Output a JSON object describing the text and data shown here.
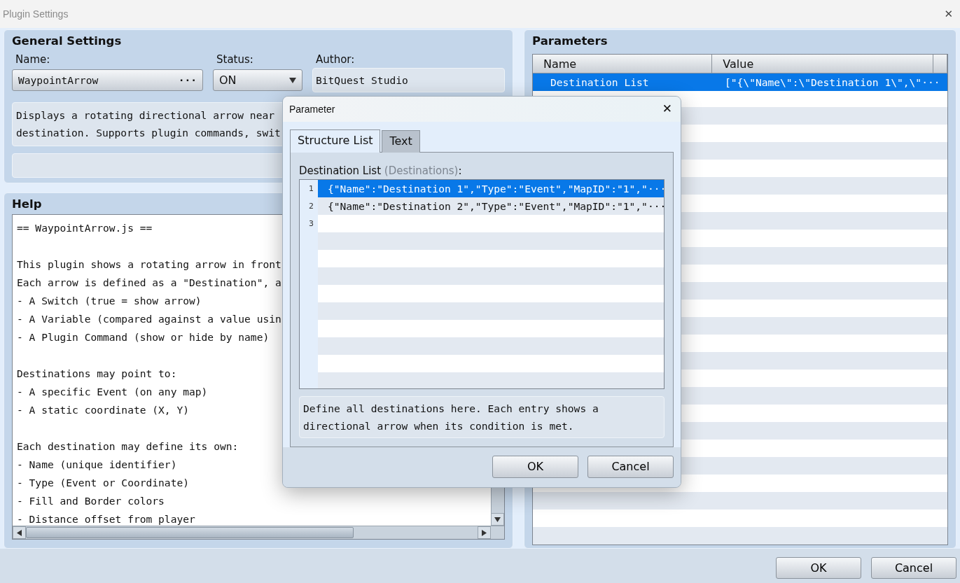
{
  "window": {
    "title": "Plugin Settings",
    "close": "✕"
  },
  "general": {
    "heading": "General Settings",
    "name_label": "Name:",
    "name_value": "WaypointArrow",
    "name_button": "···",
    "status_label": "Status:",
    "status_value": "ON",
    "author_label": "Author:",
    "author_value": "BitQuest Studio",
    "description": [
      "Displays a rotating directional arrow near",
      "destination. Supports plugin commands, swit"
    ]
  },
  "help": {
    "heading": "Help",
    "lines": [
      {
        "kind": "text",
        "text": "== WaypointArrow.js =="
      },
      {
        "kind": "blank"
      },
      {
        "kind": "text",
        "text": "This plugin shows a rotating arrow in front"
      },
      {
        "kind": "text",
        "text": "Each arrow is defined as a \"Destination\", a"
      },
      {
        "kind": "text",
        "text": "- A Switch (true = show arrow)"
      },
      {
        "kind": "text",
        "text": "- A Variable (compared against a value usin"
      },
      {
        "kind": "text",
        "text": "- A Plugin Command (show or hide by name)"
      },
      {
        "kind": "blank"
      },
      {
        "kind": "text",
        "text": "Destinations may point to:"
      },
      {
        "kind": "text",
        "text": "- A specific Event (on any map)"
      },
      {
        "kind": "text",
        "text": "- A static coordinate (X, Y)"
      },
      {
        "kind": "blank"
      },
      {
        "kind": "text",
        "text": "Each destination may define its own:"
      },
      {
        "kind": "text",
        "text": "- Name (unique identifier)"
      },
      {
        "kind": "text",
        "text": "- Type (Event or Coordinate)"
      },
      {
        "kind": "text",
        "text": "- Fill and Border colors"
      },
      {
        "kind": "text",
        "text": "- Distance offset from player"
      }
    ]
  },
  "parameters": {
    "heading": "Parameters",
    "columns": [
      "Name",
      "Value"
    ],
    "rows": [
      {
        "name": "Destination List",
        "value": "[\"{\\\"Name\\\":\\\"Destination 1\\\",\\\"···",
        "selected": true
      }
    ]
  },
  "dialog": {
    "title": "Parameter",
    "close": "✕",
    "tabs": [
      {
        "label": "Structure List",
        "selected": true
      },
      {
        "label": "Text",
        "selected": false
      }
    ],
    "list_label": "Destination List",
    "list_hint": "(Destinations)",
    "list_suffix": ":",
    "items": [
      {
        "number": "1",
        "text": "{\"Name\":\"Destination 1\",\"Type\":\"Event\",\"MapID\":\"1\",\"···",
        "selected": true
      },
      {
        "number": "2",
        "text": "{\"Name\":\"Destination 2\",\"Type\":\"Event\",\"MapID\":\"1\",\"···",
        "selected": false
      },
      {
        "number": "3",
        "selected": false
      }
    ],
    "description": [
      "Define all destinations here. Each entry shows a",
      "directional arrow when its condition is met."
    ],
    "buttons": [
      "OK",
      "Cancel"
    ]
  },
  "buttons": [
    "OK",
    "Cancel"
  ]
}
